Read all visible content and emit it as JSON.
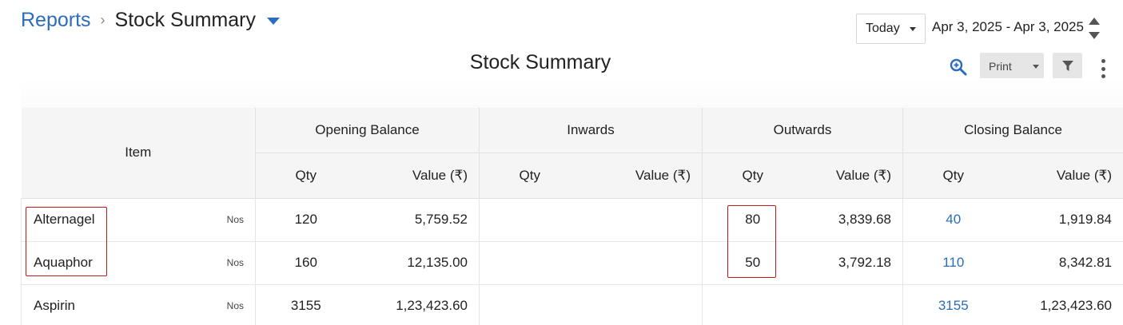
{
  "breadcrumb": {
    "parent": "Reports",
    "separator": "›",
    "current": "Stock Summary"
  },
  "date_filter": {
    "period": "Today",
    "range": "Apr 3, 2025 - Apr 3, 2025"
  },
  "report": {
    "title": "Stock Summary",
    "date": "03-04-2025"
  },
  "toolbar": {
    "print_label": "Print",
    "icons": [
      "zoom-in-icon",
      "filter-icon",
      "more-vert-icon"
    ]
  },
  "table": {
    "item_header": "Item",
    "groups": [
      "Opening Balance",
      "Inwards",
      "Outwards",
      "Closing Balance"
    ],
    "qty_header": "Qty",
    "value_header": "Value (₹)",
    "rows": [
      {
        "item": "Alternagel",
        "unit": "Nos",
        "open_qty": "120",
        "open_val": "5,759.52",
        "in_qty": "",
        "in_val": "",
        "out_qty": "80",
        "out_val": "3,839.68",
        "close_qty": "40",
        "close_val": "1,919.84"
      },
      {
        "item": "Aquaphor",
        "unit": "Nos",
        "open_qty": "160",
        "open_val": "12,135.00",
        "in_qty": "",
        "in_val": "",
        "out_qty": "50",
        "out_val": "3,792.18",
        "close_qty": "110",
        "close_val": "8,342.81"
      },
      {
        "item": "Aspirin",
        "unit": "Nos",
        "open_qty": "3155",
        "open_val": "1,23,423.60",
        "in_qty": "",
        "in_val": "",
        "out_qty": "",
        "out_val": "",
        "close_qty": "3155",
        "close_val": "1,23,423.60"
      }
    ]
  },
  "colors": {
    "link": "#2a6ebb",
    "highlight": "#c4171c",
    "header_bg": "#f5f5f5",
    "button_bg": "#e6e6e6"
  }
}
